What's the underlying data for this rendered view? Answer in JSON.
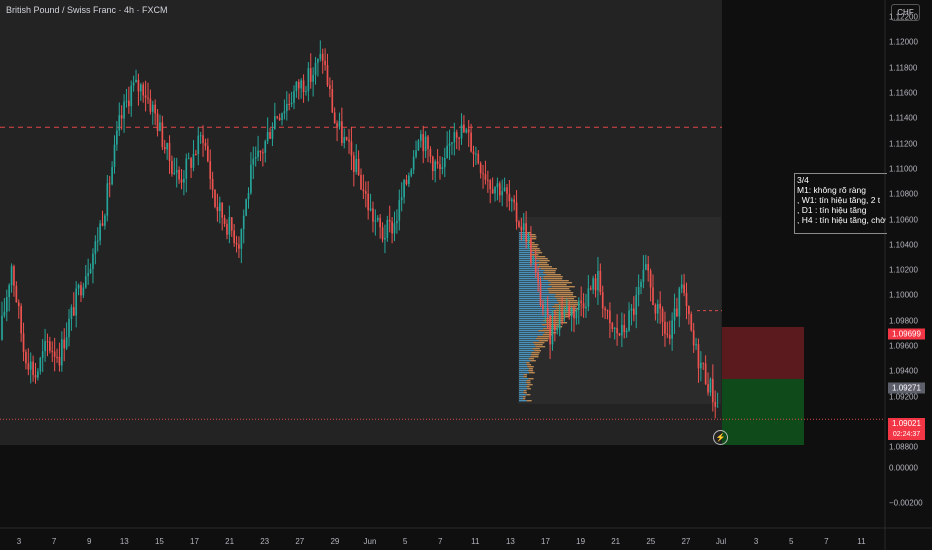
{
  "header": {
    "title": "British Pound / Swiss Franc · 4h · FXCM",
    "currency": "CHF"
  },
  "price_axis": {
    "ticks": [
      "1.12200",
      "1.12000",
      "1.11800",
      "1.11600",
      "1.11400",
      "1.11200",
      "1.11000",
      "1.10800",
      "1.10600",
      "1.10400",
      "1.10200",
      "1.10000",
      "1.09800",
      "1.09600",
      "1.09400",
      "1.09200",
      "1.08800",
      "0.00000",
      "−0.00200"
    ],
    "tick_values": [
      1.122,
      1.12,
      1.118,
      1.116,
      1.114,
      1.112,
      1.11,
      1.108,
      1.106,
      1.104,
      1.102,
      1.1,
      1.098,
      1.096,
      1.094,
      1.092,
      1.088
    ],
    "extra_ticks": [
      {
        "label": "0.00000",
        "row": "lower1"
      },
      {
        "label": "−0.00200",
        "row": "lower2"
      }
    ],
    "labels": {
      "stop": {
        "text": "1.09699",
        "value": 1.09699,
        "color": "#f23645"
      },
      "entry": {
        "text": "1.09271",
        "value": 1.09271,
        "color": "#5d606b"
      },
      "last": {
        "text": "1.09021",
        "countdown": "02:24:37",
        "value": 1.09021,
        "color": "#f23645"
      }
    }
  },
  "time_axis": {
    "labels": [
      {
        "text": "3",
        "i": 0
      },
      {
        "text": "7",
        "i": 3
      },
      {
        "text": "9",
        "i": 6
      },
      {
        "text": "13",
        "i": 9
      },
      {
        "text": "15",
        "i": 12
      },
      {
        "text": "17",
        "i": 15
      },
      {
        "text": "21",
        "i": 18
      },
      {
        "text": "23",
        "i": 21
      },
      {
        "text": "27",
        "i": 24
      },
      {
        "text": "29",
        "i": 27
      },
      {
        "text": "Jun",
        "i": 30
      },
      {
        "text": "5",
        "i": 33
      },
      {
        "text": "7",
        "i": 36
      },
      {
        "text": "11",
        "i": 39
      },
      {
        "text": "13",
        "i": 42
      },
      {
        "text": "17",
        "i": 45
      },
      {
        "text": "19",
        "i": 48
      },
      {
        "text": "21",
        "i": 51
      },
      {
        "text": "25",
        "i": 54
      },
      {
        "text": "27",
        "i": 57
      },
      {
        "text": "Jul",
        "i": 60
      },
      {
        "text": "3",
        "i": 63
      },
      {
        "text": "5",
        "i": 66
      },
      {
        "text": "7",
        "i": 69
      },
      {
        "text": "11",
        "i": 72
      }
    ]
  },
  "note": {
    "lines": [
      "3/4",
      "M1: không rõ ràng",
      ", W1: tín hiệu tăng, 2 t",
      ", D1 : tín hiệu tăng",
      ", H4 : tín hiệu tăng, chờ"
    ]
  },
  "colors": {
    "up": "#26a69a",
    "down": "#ef5350",
    "bg": "#0f0f0f",
    "profile_up": "#4fa3d1",
    "profile_down": "#d49a5a",
    "dash": "#e04848"
  },
  "chart_data": {
    "type": "candlestick",
    "symbol": "GBPCHF",
    "interval": "4h",
    "ylim": [
      1.0862,
      1.1232
    ],
    "levels": {
      "resistance": 1.1133,
      "support": 1.09021,
      "target_line": 1.0988
    },
    "position": {
      "entry": 1.09271,
      "stop": 1.09699,
      "target": 1.0865
    },
    "anchors": [
      1.0965,
      1.1025,
      1.0958,
      1.0937,
      1.0962,
      1.0953,
      1.0985,
      1.1015,
      1.1039,
      1.108,
      1.1135,
      1.1164,
      1.1165,
      1.1143,
      1.1112,
      1.1092,
      1.1107,
      1.1128,
      1.1073,
      1.1057,
      1.1043,
      1.1096,
      1.1116,
      1.1142,
      1.1152,
      1.1166,
      1.1173,
      1.119,
      1.1138,
      1.1118,
      1.1095,
      1.1066,
      1.1048,
      1.1057,
      1.109,
      1.1131,
      1.111,
      1.1095,
      1.1134,
      1.1128,
      1.1108,
      1.109,
      1.1085,
      1.1065,
      1.105,
      1.1005,
      1.0968,
      1.099,
      1.0988,
      1.1,
      1.1013,
      1.0973,
      1.097,
      1.099,
      1.1018,
      1.0985,
      1.0965,
      1.1005,
      1.096,
      1.0937,
      1.0912
    ]
  }
}
